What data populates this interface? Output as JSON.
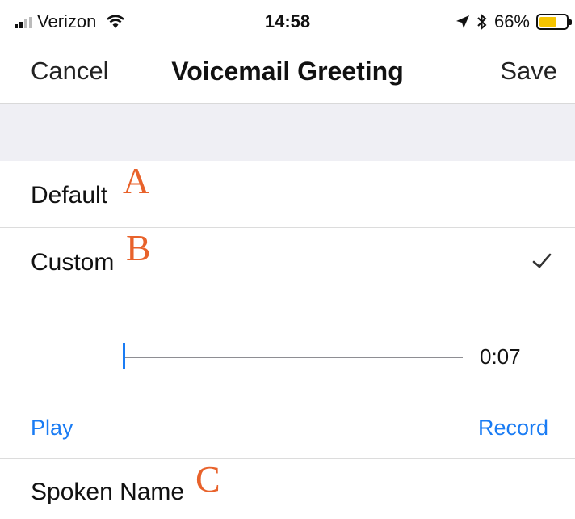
{
  "status_bar": {
    "carrier": "Verizon",
    "time": "14:58",
    "battery_percent": "66%",
    "battery_level": 0.66,
    "icons": [
      "signal-icon",
      "wifi-icon",
      "location-arrow-icon",
      "bluetooth-icon",
      "battery-icon"
    ]
  },
  "nav": {
    "cancel_label": "Cancel",
    "title": "Voicemail Greeting",
    "save_label": "Save"
  },
  "options": [
    {
      "label": "Default",
      "annotation": "A",
      "selected": false
    },
    {
      "label": "Custom",
      "annotation": "B",
      "selected": true
    }
  ],
  "player": {
    "duration": "0:07",
    "progress": 0.0,
    "play_label": "Play",
    "record_label": "Record"
  },
  "spoken_name": {
    "label": "Spoken Name",
    "annotation": "C"
  },
  "colors": {
    "accent": "#1a7cf4",
    "annotation": "#e8622b",
    "battery": "#f5c400",
    "group_background": "#efeff4"
  }
}
